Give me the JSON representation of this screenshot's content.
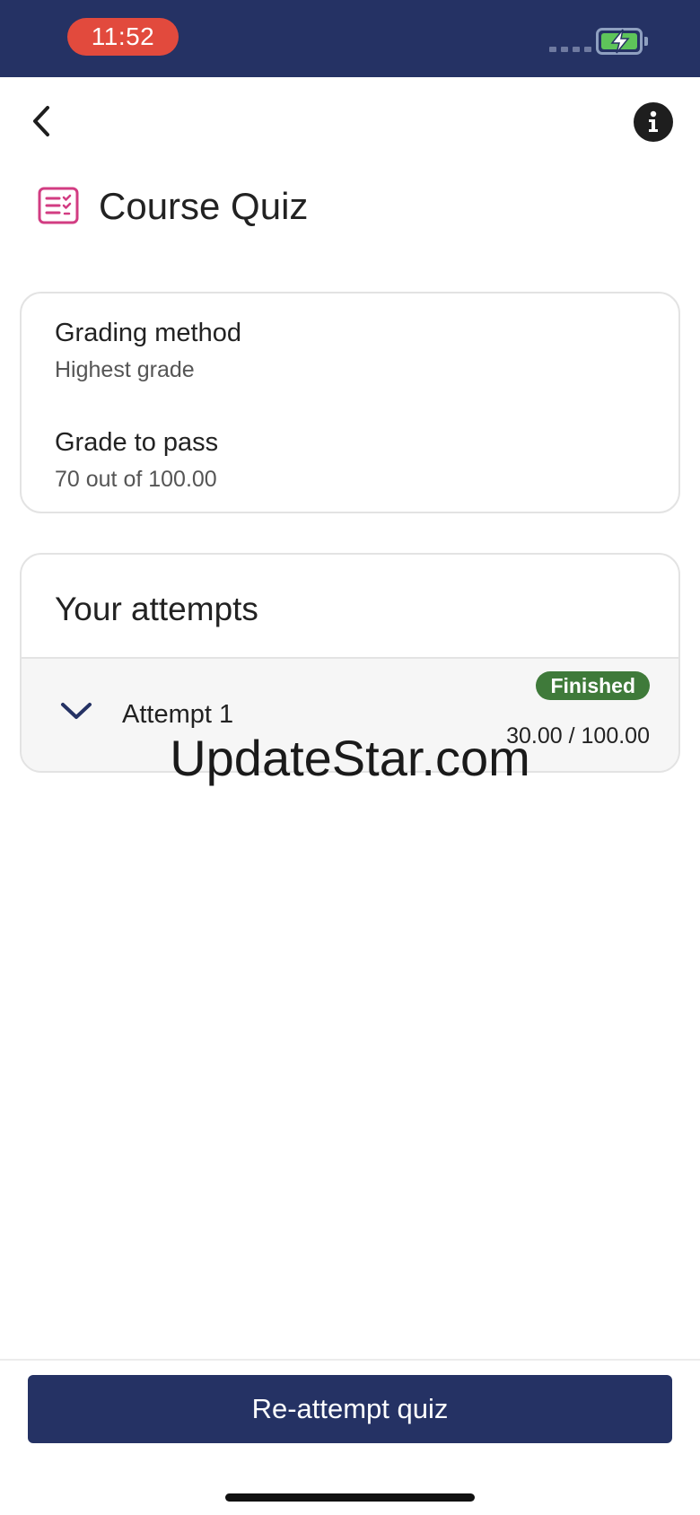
{
  "status_bar": {
    "time": "11:52",
    "colors": {
      "background": "#253264",
      "time_pill": "#e24a3d",
      "battery_fill": "#5ec45a"
    },
    "icons": [
      "signal-dots-icon",
      "battery-charging-icon"
    ]
  },
  "header": {
    "back_icon": "chevron-left-icon",
    "info_icon": "info-icon"
  },
  "page": {
    "title": "Course Quiz",
    "title_icon": "quiz-checklist-icon",
    "title_icon_color": "#d23c82"
  },
  "grading": {
    "method_label": "Grading method",
    "method_value": "Highest grade",
    "pass_label": "Grade to pass",
    "pass_value": "70 out of 100.00"
  },
  "attempts": {
    "title": "Your attempts",
    "items": [
      {
        "label": "Attempt 1",
        "status": "Finished",
        "score": "30.00 / 100.00",
        "icon": "chevron-down-icon"
      }
    ],
    "status_color": "#3f7a3a"
  },
  "watermark": "UpdateStar.com",
  "footer": {
    "reattempt_label": "Re-attempt quiz",
    "button_color": "#253264"
  }
}
